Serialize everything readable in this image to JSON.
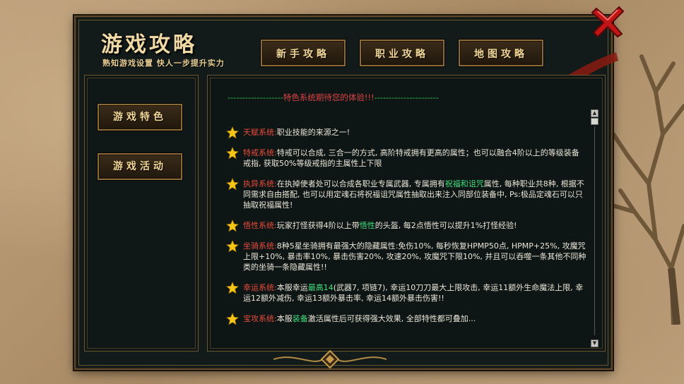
{
  "panel": {
    "title": "游戏攻略",
    "subtitle": "熟知游戏设置 快人一步提升实力"
  },
  "top_tabs": [
    {
      "label": "新手攻略"
    },
    {
      "label": "职业攻略"
    },
    {
      "label": "地图攻略"
    }
  ],
  "side_tabs": [
    {
      "label": "游戏特色"
    },
    {
      "label": "游戏活动"
    }
  ],
  "content": {
    "banner_dashes_left": "-------------------",
    "banner_text": "特色系统期待您的体验!!!",
    "banner_dashes_right": "----------------------",
    "entries": [
      {
        "name": "天赋系统",
        "sep": ":",
        "text": "职业技能的来源之一!"
      },
      {
        "name": "特戒系统",
        "sep": ":",
        "text": "特戒可以合成, 三合一的方式, 高阶特戒拥有更高的属性；也可以融合4阶以上的等级装备戒指, 获取50%等级戒指的主属性上下限"
      },
      {
        "name": "执异系统",
        "sep": ":",
        "text_a": "在执掉使者处可以合成各职业专属武器, 专属拥有",
        "hl_a": "祝福和诅咒",
        "text_b": "属性, 每种职业共8种, 根据不同需求自由搭配, 也可以用定魂石将祝福诅咒属性抽取出来注入同部位装备中, Ps:极品定魂石可以只抽取祝福属性!"
      },
      {
        "name": "悟性系统",
        "sep": ":",
        "text_a": "玩家打怪获得4阶以上带",
        "hl_a": "悟性",
        "text_b": "的头盔, 每2点悟性可以提升1%打怪经验!"
      },
      {
        "name": "坐骑系统",
        "sep": ":",
        "text": "8种5星坐骑拥有最强大的隐藏属性:免伤10%, 每秒恢复HPMP50点, HPMP+25%, 攻魔咒上限+10%, 暴击率10%, 暴击伤害20%, 攻速20%, 攻魔咒下限10%, 并且可以吞噬一条其他不同种类的坐骑一条隐藏属性!!"
      },
      {
        "name": "幸运系统",
        "sep": ":",
        "text_a": "本服幸运",
        "hl_a": "最高14",
        "text_b": "(武器7, 项链7), 幸运10刀刀最大上限攻击, 幸运11额外生命魔法上限, 幸运12额外减伤, 幸运13额外暴击率, 幸运14额外暴击伤害!!"
      },
      {
        "name": "宝攻系统",
        "sep": ":",
        "text_a": "本服",
        "hl_a": "装备",
        "text_b": "激活属性后可获得强大效果, 全部特性都可叠加..."
      }
    ]
  },
  "scrollbar": {
    "up": "▲",
    "down": "▼"
  },
  "colors": {
    "panel_bg": "#121a1a",
    "gold_border": "#8b6a36",
    "title_text": "#f0d9a4",
    "entry_name": "#e84b3a",
    "highlight": "#41e07e",
    "banner_red": "#e04444",
    "banner_green": "#2fbf4d"
  },
  "icons": {
    "close": "red-x-icon",
    "entry_marker": "gold-star-icon"
  }
}
